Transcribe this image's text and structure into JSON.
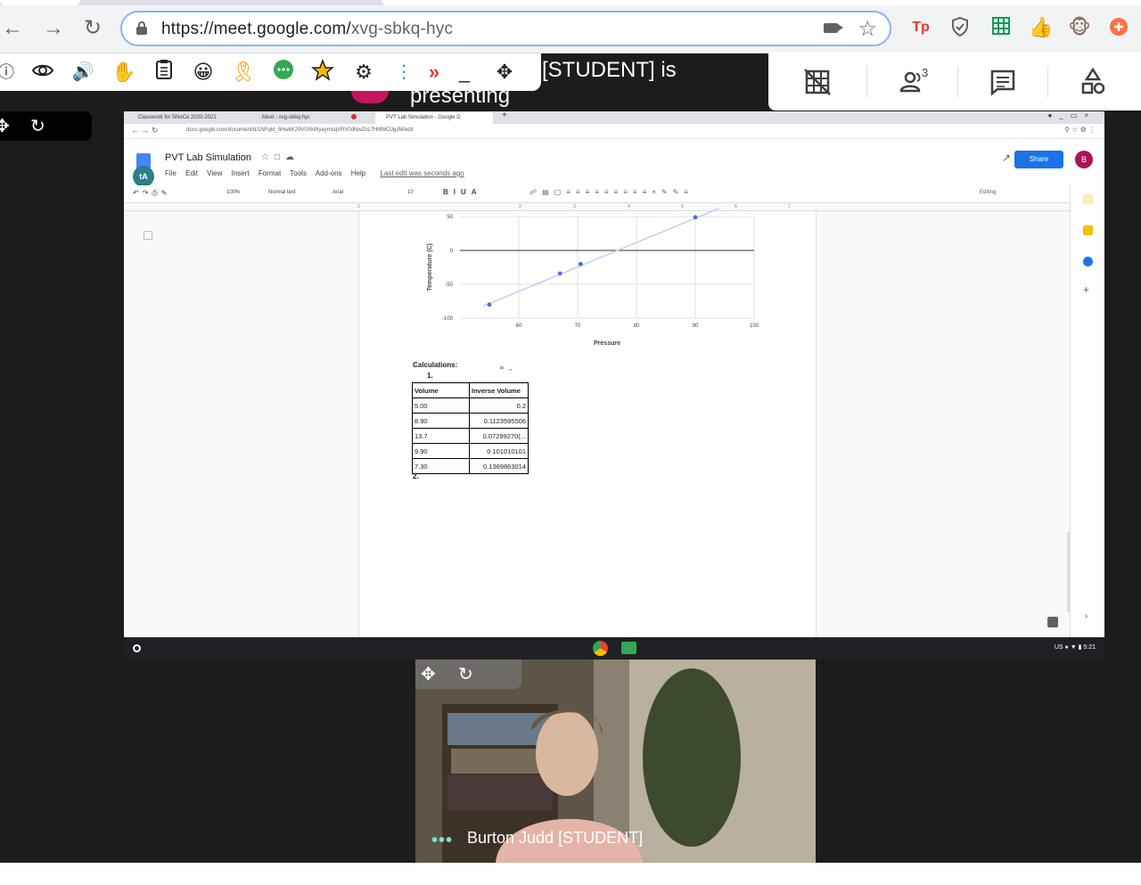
{
  "browser": {
    "url_host": "https://meet.google.com/",
    "url_path": "xvg-sbkq-hyc",
    "extensions": [
      {
        "name": "tp-extension-icon",
        "label": "Tp",
        "color": "#e53935"
      },
      {
        "name": "shield-extension-icon",
        "label": "",
        "color": "#5f6368"
      },
      {
        "name": "sheets-extension-icon",
        "label": "",
        "color": "#0f9d58"
      },
      {
        "name": "thumbs-up-extension-icon",
        "label": "",
        "color": "#fbbc04"
      },
      {
        "name": "monkey-extension-icon",
        "label": "",
        "color": "#8d6e63"
      },
      {
        "name": "plus-extension-icon",
        "label": "",
        "color": "#ff7043"
      }
    ]
  },
  "meet": {
    "presenting_line1": "[STUDENT] is",
    "presenting_line2": "presenting",
    "participant_count": "3",
    "participant_name": "Burton Judd [STUDENT]"
  },
  "shared_screen": {
    "tabs": [
      "Classwork for SNoCo 2020-2021",
      "Meet - xvg-sbkq-hyc",
      "PVT Lab Simulation - Google D"
    ],
    "address": "docs.google.com/document/d/1NFqkt_5HwkK29V0XkWyaymsqVRV0dNwZoz7HMMOJgJM/edit",
    "doc_title": "PVT Lab Simulation",
    "menu": [
      "File",
      "Edit",
      "View",
      "Insert",
      "Format",
      "Tools",
      "Add-ons",
      "Help"
    ],
    "last_edit": "Last edit was seconds ago",
    "share_label": "Share",
    "account_initial": "B",
    "editing_label": "Editing",
    "toolbar": {
      "zoom": "100%",
      "style": "Normal text",
      "font": "Arial",
      "size": "10"
    },
    "ruler_marks": [
      "1",
      "2",
      "3",
      "4",
      "5",
      "6",
      "7"
    ],
    "calculations_label": "Calculations:",
    "item1": "1.",
    "item2": "2.",
    "table": {
      "headers": [
        "Volume",
        "Inverse Volume"
      ],
      "rows": [
        [
          "5.00",
          "0.2"
        ],
        [
          "8.90",
          "0.1123595506"
        ],
        [
          "13.7",
          "0.07299270(..."
        ],
        [
          "9.90",
          "0.101010101"
        ],
        [
          "7.30",
          "0.1369863014"
        ]
      ]
    },
    "shelf_time": "5:21",
    "shelf_locale": "US"
  },
  "chart_data": {
    "type": "scatter",
    "xlabel": "Pressure",
    "ylabel": "Temperature (C)",
    "xlim": [
      50,
      100
    ],
    "ylim": [
      -100,
      50
    ],
    "x_ticks": [
      "60",
      "70",
      "80",
      "90",
      "100"
    ],
    "y_ticks": [
      "50",
      "0",
      "-50",
      "-100"
    ],
    "points": [
      {
        "x": 55,
        "y": -80
      },
      {
        "x": 67,
        "y": -34
      },
      {
        "x": 70.5,
        "y": -20
      },
      {
        "x": 90,
        "y": 49
      }
    ],
    "trendline": {
      "from": [
        54,
        -82
      ],
      "to": [
        94,
        62
      ]
    },
    "point_color": "#4a6fd6",
    "trendline_color": "#c5cdf0"
  }
}
